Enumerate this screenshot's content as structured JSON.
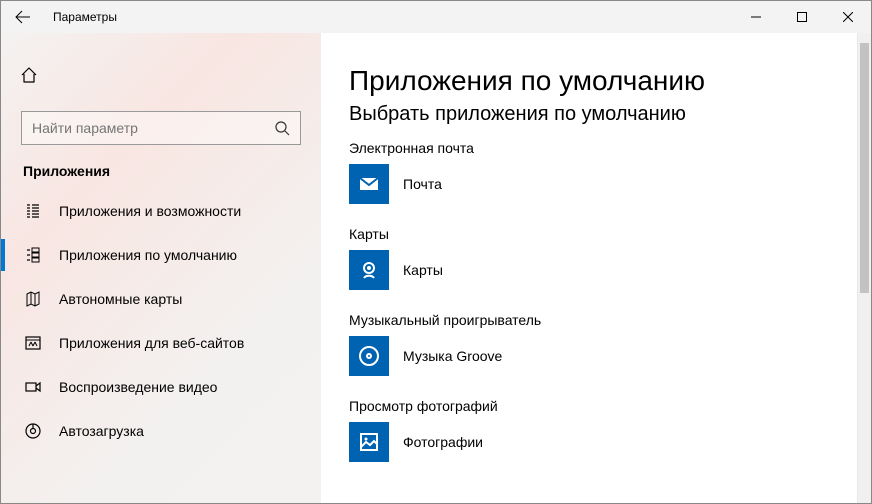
{
  "window": {
    "title": "Параметры"
  },
  "search": {
    "placeholder": "Найти параметр"
  },
  "section": {
    "header": "Приложения"
  },
  "nav": {
    "items": [
      {
        "label": "Приложения и возможности"
      },
      {
        "label": "Приложения по умолчанию"
      },
      {
        "label": "Автономные карты"
      },
      {
        "label": "Приложения для веб-сайтов"
      },
      {
        "label": "Воспроизведение видео"
      },
      {
        "label": "Автозагрузка"
      }
    ]
  },
  "page": {
    "h1": "Приложения по умолчанию",
    "h2": "Выбрать приложения по умолчанию"
  },
  "defaults": {
    "email": {
      "label": "Электронная почта",
      "app": "Почта"
    },
    "maps": {
      "label": "Карты",
      "app": "Карты"
    },
    "music": {
      "label": "Музыкальный проигрыватель",
      "app": "Музыка Groove"
    },
    "photos": {
      "label": "Просмотр фотографий",
      "app": "Фотографии"
    }
  }
}
